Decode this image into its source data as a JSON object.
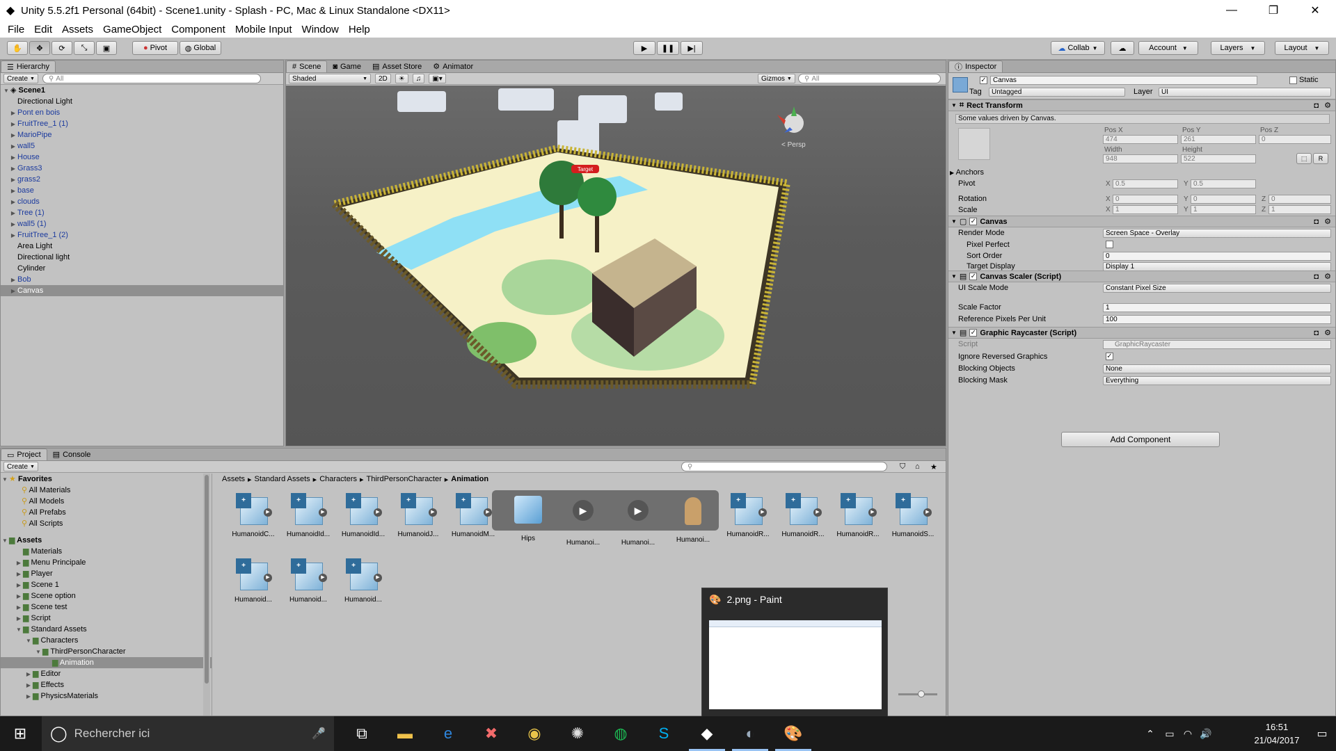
{
  "window": {
    "title": "Unity 5.5.2f1 Personal (64bit) - Scene1.unity - Splash - PC, Mac & Linux Standalone <DX11>",
    "minimize": "—",
    "maximize": "❐",
    "close": "✕"
  },
  "menu": [
    "File",
    "Edit",
    "Assets",
    "GameObject",
    "Component",
    "Mobile Input",
    "Window",
    "Help"
  ],
  "toolbar": {
    "pivot": "Pivot",
    "global": "Global",
    "collab": "Collab",
    "account": "Account",
    "layers": "Layers",
    "layout": "Layout"
  },
  "hierarchy": {
    "tab": "Hierarchy",
    "create": "Create",
    "search_placeholder": "All",
    "scene": "Scene1",
    "items": [
      {
        "label": "Directional Light",
        "blue": false,
        "arrow": false
      },
      {
        "label": "Pont en bois",
        "blue": true,
        "arrow": true
      },
      {
        "label": "FruitTree_1 (1)",
        "blue": true,
        "arrow": true
      },
      {
        "label": "MarioPipe",
        "blue": true,
        "arrow": true
      },
      {
        "label": "wall5",
        "blue": true,
        "arrow": true
      },
      {
        "label": "House",
        "blue": true,
        "arrow": true
      },
      {
        "label": "Grass3",
        "blue": true,
        "arrow": true
      },
      {
        "label": "grass2",
        "blue": true,
        "arrow": true
      },
      {
        "label": "base",
        "blue": true,
        "arrow": true
      },
      {
        "label": "clouds",
        "blue": true,
        "arrow": true
      },
      {
        "label": "Tree (1)",
        "blue": true,
        "arrow": true
      },
      {
        "label": "wall5 (1)",
        "blue": true,
        "arrow": true
      },
      {
        "label": "FruitTree_1 (2)",
        "blue": true,
        "arrow": true
      },
      {
        "label": "Area Light",
        "blue": false,
        "arrow": false
      },
      {
        "label": "Directional light",
        "blue": false,
        "arrow": false
      },
      {
        "label": "Cylinder",
        "blue": false,
        "arrow": false
      },
      {
        "label": "Bob",
        "blue": true,
        "arrow": true
      },
      {
        "label": "Canvas",
        "blue": false,
        "arrow": true,
        "selected": true
      }
    ]
  },
  "scene": {
    "tabs": [
      "Scene",
      "Game",
      "Asset Store",
      "Animator"
    ],
    "shaded": "Shaded",
    "mode_2d": "2D",
    "gizmos": "Gizmos",
    "search_placeholder": "All",
    "persp": "< Persp",
    "target_label": "Target"
  },
  "inspector": {
    "tab": "Inspector",
    "object_name": "Canvas",
    "static_label": "Static",
    "tag_label": "Tag",
    "tag_value": "Untagged",
    "layer_label": "Layer",
    "layer_value": "UI",
    "rect_transform": {
      "title": "Rect Transform",
      "note": "Some values driven by Canvas.",
      "pos_x_label": "Pos X",
      "pos_y_label": "Pos Y",
      "pos_z_label": "Pos Z",
      "pos_x": "474",
      "pos_y": "261",
      "pos_z": "0",
      "width_label": "Width",
      "height_label": "Height",
      "width": "948",
      "height": "522",
      "anchors": "Anchors",
      "pivot_label": "Pivot",
      "pivot_x": "0.5",
      "pivot_y": "0.5",
      "rotation_label": "Rotation",
      "rot_x": "0",
      "rot_y": "0",
      "rot_z": "0",
      "scale_label": "Scale",
      "scale_x": "1",
      "scale_y": "1",
      "scale_z": "1",
      "x": "X",
      "y": "Y",
      "z": "Z",
      "r": "R"
    },
    "canvas": {
      "title": "Canvas",
      "render_mode_label": "Render Mode",
      "render_mode": "Screen Space - Overlay",
      "pixel_perfect_label": "Pixel Perfect",
      "sort_order_label": "Sort Order",
      "sort_order": "0",
      "target_display_label": "Target Display",
      "target_display": "Display 1"
    },
    "canvas_scaler": {
      "title": "Canvas Scaler (Script)",
      "ui_scale_mode_label": "UI Scale Mode",
      "ui_scale_mode": "Constant Pixel Size",
      "scale_factor_label": "Scale Factor",
      "scale_factor": "1",
      "ref_ppu_label": "Reference Pixels Per Unit",
      "ref_ppu": "100"
    },
    "raycaster": {
      "title": "Graphic Raycaster (Script)",
      "script_label": "Script",
      "script": "GraphicRaycaster",
      "ignore_label": "Ignore Reversed Graphics",
      "blocking_objects_label": "Blocking Objects",
      "blocking_objects": "None",
      "blocking_mask_label": "Blocking Mask",
      "blocking_mask": "Everything"
    },
    "add_component": "Add Component"
  },
  "project": {
    "tabs": [
      "Project",
      "Console"
    ],
    "create": "Create",
    "favorites_label": "Favorites",
    "favorites": [
      "All Materials",
      "All Models",
      "All Prefabs",
      "All Scripts"
    ],
    "assets_label": "Assets",
    "folders": [
      {
        "label": "Materials",
        "indent": 1,
        "arrow": false
      },
      {
        "label": "Menu Principale",
        "indent": 1,
        "arrow": true
      },
      {
        "label": "Player",
        "indent": 1,
        "arrow": true
      },
      {
        "label": "Scene 1",
        "indent": 1,
        "arrow": true
      },
      {
        "label": "Scene option",
        "indent": 1,
        "arrow": true
      },
      {
        "label": "Scene test",
        "indent": 1,
        "arrow": true
      },
      {
        "label": "Script",
        "indent": 1,
        "arrow": true
      },
      {
        "label": "Standard Assets",
        "indent": 1,
        "arrow": true,
        "open": true
      },
      {
        "label": "Characters",
        "indent": 2,
        "arrow": true,
        "open": true
      },
      {
        "label": "ThirdPersonCharacter",
        "indent": 3,
        "arrow": true,
        "open": true
      },
      {
        "label": "Animation",
        "indent": 4,
        "arrow": false,
        "selected": true
      },
      {
        "label": "Editor",
        "indent": 2,
        "arrow": true
      },
      {
        "label": "Effects",
        "indent": 2,
        "arrow": true
      },
      {
        "label": "PhysicsMaterials",
        "indent": 2,
        "arrow": true
      }
    ],
    "breadcrumb": [
      "Assets",
      "Standard Assets",
      "Characters",
      "ThirdPersonCharacter",
      "Animation"
    ],
    "assets_row1": [
      "HumanoidC...",
      "HumanoidId...",
      "HumanoidId...",
      "HumanoidJ...",
      "HumanoidM...",
      "Hips",
      "Humanoi...",
      "Humanoi...",
      "Humanoi...",
      "HumanoidR...",
      "HumanoidR...",
      "HumanoidR...",
      "HumanoidS..."
    ],
    "assets_row2": [
      "Humanoid...",
      "Humanoid...",
      "Humanoid..."
    ]
  },
  "paint_preview": {
    "title": "2.png - Paint"
  },
  "taskbar": {
    "search_placeholder": "Rechercher ici",
    "time": "16:51",
    "date": "21/04/2017"
  }
}
